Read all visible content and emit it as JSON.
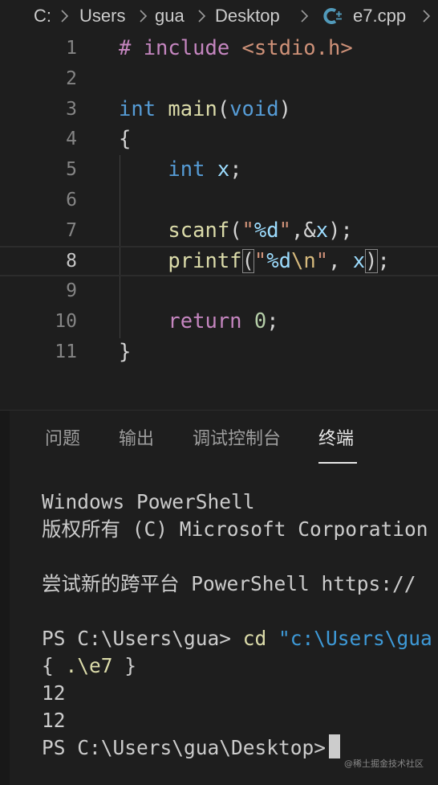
{
  "breadcrumb": {
    "items": [
      "C:",
      "Users",
      "gua",
      "Desktop",
      "e7.cpp"
    ],
    "file_icon": "cpp-file-icon"
  },
  "editor": {
    "current_line": 8,
    "lines": [
      {
        "n": "1",
        "tokens": [
          {
            "t": "# include ",
            "c": "dir"
          },
          {
            "t": "<stdio.h>",
            "c": "str"
          }
        ]
      },
      {
        "n": "2",
        "tokens": []
      },
      {
        "n": "3",
        "tokens": [
          {
            "t": "int",
            "c": "kw"
          },
          {
            "t": " ",
            "c": "pun"
          },
          {
            "t": "main",
            "c": "fn"
          },
          {
            "t": "(",
            "c": "pun"
          },
          {
            "t": "void",
            "c": "kw"
          },
          {
            "t": ")",
            "c": "pun"
          }
        ]
      },
      {
        "n": "4",
        "tokens": [
          {
            "t": "{",
            "c": "pun"
          }
        ]
      },
      {
        "n": "5",
        "tokens": [
          {
            "t": "    ",
            "c": "pun"
          },
          {
            "t": "int",
            "c": "kw"
          },
          {
            "t": " ",
            "c": "pun"
          },
          {
            "t": "x",
            "c": "var"
          },
          {
            "t": ";",
            "c": "pun"
          }
        ]
      },
      {
        "n": "6",
        "tokens": []
      },
      {
        "n": "7",
        "tokens": [
          {
            "t": "    ",
            "c": "pun"
          },
          {
            "t": "scanf",
            "c": "fn"
          },
          {
            "t": "(",
            "c": "pun"
          },
          {
            "t": "\"",
            "c": "str"
          },
          {
            "t": "%d",
            "c": "fmt"
          },
          {
            "t": "\"",
            "c": "str"
          },
          {
            "t": ",&",
            "c": "pun"
          },
          {
            "t": "x",
            "c": "var"
          },
          {
            "t": ");",
            "c": "pun"
          }
        ]
      },
      {
        "n": "8",
        "tokens": [
          {
            "t": "    ",
            "c": "pun"
          },
          {
            "t": "printf",
            "c": "fn"
          },
          {
            "t": "(",
            "c": "match"
          },
          {
            "t": "\"",
            "c": "str"
          },
          {
            "t": "%d",
            "c": "fmt"
          },
          {
            "t": "\\n",
            "c": "esc"
          },
          {
            "t": "\"",
            "c": "str"
          },
          {
            "t": ", ",
            "c": "pun"
          },
          {
            "t": "x",
            "c": "var"
          },
          {
            "t": ")",
            "c": "match"
          },
          {
            "t": ";",
            "c": "pun"
          }
        ]
      },
      {
        "n": "9",
        "tokens": []
      },
      {
        "n": "10",
        "tokens": [
          {
            "t": "    ",
            "c": "pun"
          },
          {
            "t": "return",
            "c": "ctl"
          },
          {
            "t": " ",
            "c": "pun"
          },
          {
            "t": "0",
            "c": "num"
          },
          {
            "t": ";",
            "c": "pun"
          }
        ]
      },
      {
        "n": "11",
        "tokens": [
          {
            "t": "}",
            "c": "pun"
          }
        ]
      }
    ]
  },
  "panel": {
    "tabs": [
      {
        "label": "问题",
        "active": false
      },
      {
        "label": "输出",
        "active": false
      },
      {
        "label": "调试控制台",
        "active": false
      },
      {
        "label": "终端",
        "active": true
      }
    ],
    "terminal_lines": [
      [
        {
          "t": "Windows PowerShell",
          "c": "out"
        }
      ],
      [
        {
          "t": "版权所有 (C) Microsoft Corporation",
          "c": "out"
        }
      ],
      [],
      [
        {
          "t": "尝试新的跨平台 PowerShell https://",
          "c": "out"
        }
      ],
      [],
      [
        {
          "t": "PS C:\\Users\\gua> ",
          "c": "out"
        },
        {
          "t": "cd",
          "c": "cmd"
        },
        {
          "t": " ",
          "c": "out"
        },
        {
          "t": "\"c:\\Users\\gua",
          "c": "str"
        }
      ],
      [
        {
          "t": "{ ",
          "c": "out"
        },
        {
          "t": ".\\e7",
          "c": "cmd"
        },
        {
          "t": " }",
          "c": "out"
        }
      ],
      [
        {
          "t": "12",
          "c": "out"
        }
      ],
      [
        {
          "t": "12",
          "c": "out"
        }
      ],
      [
        {
          "t": "PS C:\\Users\\gua\\Desktop>",
          "c": "out"
        }
      ]
    ],
    "prompt_line_index": 9
  },
  "watermark": "@稀土掘金技术社区",
  "colors": {
    "background": "#1e1e1e",
    "keyword": "#569cd6",
    "function": "#dcdcaa",
    "string": "#ce9178",
    "directive": "#c586c0",
    "variable": "#9cdcfe",
    "number": "#b5cea8"
  }
}
